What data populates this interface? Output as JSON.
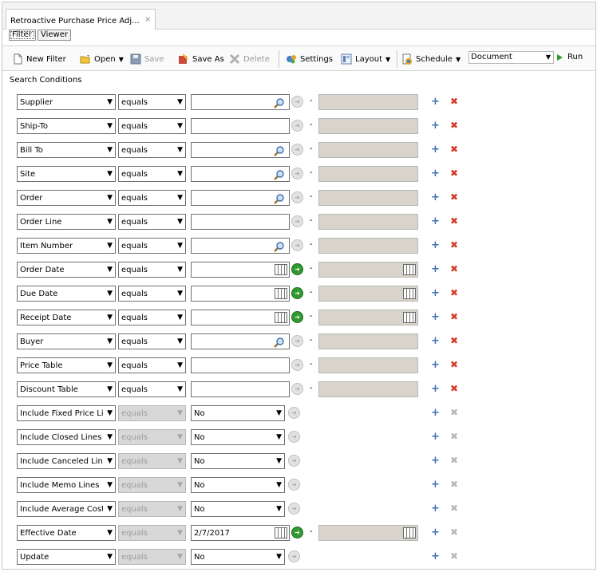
{
  "window": {
    "tab_title": "Retroactive Purchase Price Adj...",
    "tab_close": "×"
  },
  "subtabs": [
    {
      "label": "Filter",
      "active": true
    },
    {
      "label": "Viewer",
      "active": false
    }
  ],
  "toolbar": {
    "new_filter": "New Filter",
    "open": "Open",
    "save": "Save",
    "save_as": "Save As",
    "delete": "Delete",
    "settings": "Settings",
    "layout": "Layout",
    "schedule": "Schedule",
    "document_value": "Document",
    "run": "Run"
  },
  "search_conditions_label": "Search Conditions",
  "rows": [
    {
      "field": "Supplier",
      "op": "equals",
      "op_enabled": true,
      "kind": "lookup",
      "value": "",
      "has_to": true,
      "to_cal": false,
      "del_enabled": true
    },
    {
      "field": "Ship-To",
      "op": "equals",
      "op_enabled": true,
      "kind": "text",
      "value": "",
      "has_to": true,
      "to_cal": false,
      "del_enabled": true
    },
    {
      "field": "Bill To",
      "op": "equals",
      "op_enabled": true,
      "kind": "lookup",
      "value": "",
      "has_to": true,
      "to_cal": false,
      "del_enabled": true
    },
    {
      "field": "Site",
      "op": "equals",
      "op_enabled": true,
      "kind": "lookup",
      "value": "",
      "has_to": true,
      "to_cal": false,
      "del_enabled": true
    },
    {
      "field": "Order",
      "op": "equals",
      "op_enabled": true,
      "kind": "lookup",
      "value": "",
      "has_to": true,
      "to_cal": false,
      "del_enabled": true
    },
    {
      "field": "Order Line",
      "op": "equals",
      "op_enabled": true,
      "kind": "text",
      "value": "",
      "has_to": true,
      "to_cal": false,
      "del_enabled": true
    },
    {
      "field": "Item Number",
      "op": "equals",
      "op_enabled": true,
      "kind": "lookup",
      "value": "",
      "has_to": true,
      "to_cal": false,
      "del_enabled": true
    },
    {
      "field": "Order Date",
      "op": "equals",
      "op_enabled": true,
      "kind": "date",
      "value": "",
      "has_to": true,
      "to_cal": true,
      "del_enabled": true
    },
    {
      "field": "Due Date",
      "op": "equals",
      "op_enabled": true,
      "kind": "date",
      "value": "",
      "has_to": true,
      "to_cal": true,
      "del_enabled": true
    },
    {
      "field": "Receipt Date",
      "op": "equals",
      "op_enabled": true,
      "kind": "date",
      "value": "",
      "has_to": true,
      "to_cal": true,
      "del_enabled": true
    },
    {
      "field": "Buyer",
      "op": "equals",
      "op_enabled": true,
      "kind": "lookup",
      "value": "",
      "has_to": true,
      "to_cal": false,
      "del_enabled": true
    },
    {
      "field": "Price Table",
      "op": "equals",
      "op_enabled": true,
      "kind": "text",
      "value": "",
      "has_to": true,
      "to_cal": false,
      "del_enabled": true
    },
    {
      "field": "Discount Table",
      "op": "equals",
      "op_enabled": true,
      "kind": "text",
      "value": "",
      "has_to": true,
      "to_cal": false,
      "del_enabled": true
    },
    {
      "field": "Include Fixed Price Li",
      "op": "equals",
      "op_enabled": false,
      "kind": "select",
      "value": "No",
      "has_to": false,
      "to_cal": false,
      "del_enabled": false
    },
    {
      "field": "Include Closed Lines",
      "op": "equals",
      "op_enabled": false,
      "kind": "select",
      "value": "No",
      "has_to": false,
      "to_cal": false,
      "del_enabled": false
    },
    {
      "field": "Include Canceled Lin",
      "op": "equals",
      "op_enabled": false,
      "kind": "select",
      "value": "No",
      "has_to": false,
      "to_cal": false,
      "del_enabled": false
    },
    {
      "field": "Include Memo Lines",
      "op": "equals",
      "op_enabled": false,
      "kind": "select",
      "value": "No",
      "has_to": false,
      "to_cal": false,
      "del_enabled": false
    },
    {
      "field": "Include Average Cost",
      "op": "equals",
      "op_enabled": false,
      "kind": "select",
      "value": "No",
      "has_to": false,
      "to_cal": false,
      "del_enabled": false
    },
    {
      "field": "Effective Date",
      "op": "equals",
      "op_enabled": false,
      "kind": "date",
      "value": "2/7/2017",
      "has_to": true,
      "to_cal": true,
      "del_enabled": false
    },
    {
      "field": "Update",
      "op": "equals",
      "op_enabled": false,
      "kind": "select",
      "value": "No",
      "has_to": false,
      "to_cal": false,
      "del_enabled": false
    }
  ],
  "icons": {
    "add": "+",
    "remove": "✖",
    "dropdown": "▼",
    "dash": "-"
  }
}
